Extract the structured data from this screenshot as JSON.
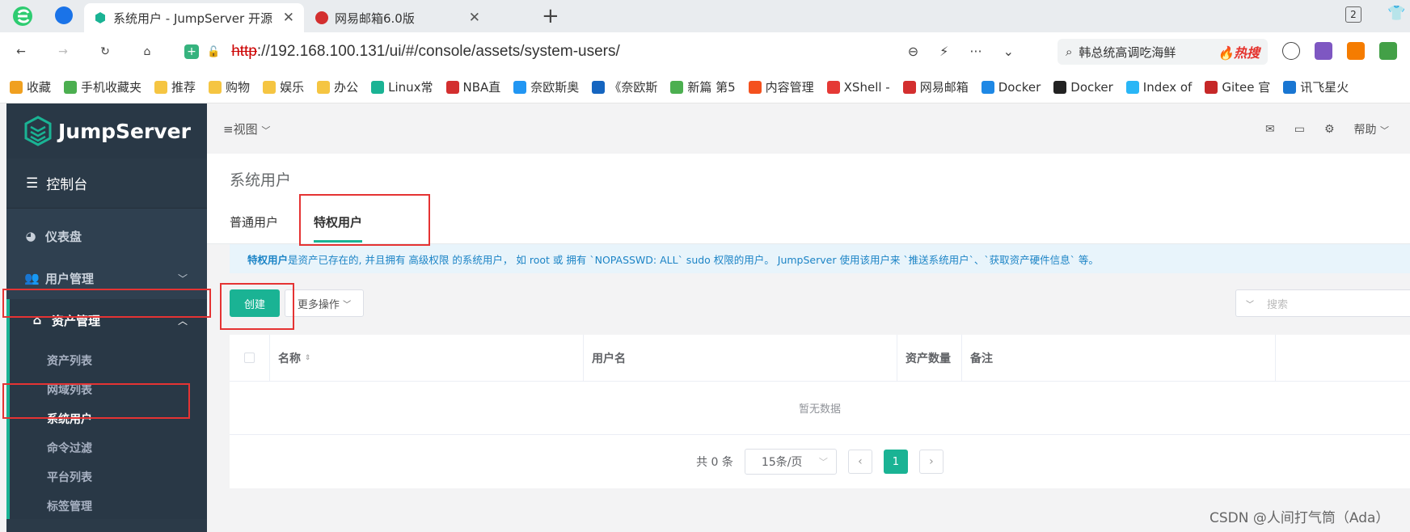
{
  "browser": {
    "tabs": [
      {
        "title": "系统用户 - JumpServer 开源",
        "close": "✕"
      },
      {
        "title": "网易邮箱6.0版",
        "close": "✕"
      }
    ],
    "new_tab": "+",
    "tab_count": "2",
    "url_scheme": "http",
    "url_rest": "://192.168.100.131/ui/#/console/assets/system-users/",
    "search_text": "韩总统高调吃海鲜",
    "search_hot": "🔥热搜"
  },
  "bookmarks": [
    {
      "label": "收藏",
      "color": "#f0a020"
    },
    {
      "label": "手机收藏夹",
      "color": "#4caf50"
    },
    {
      "label": "推荐",
      "color": "#f5c542"
    },
    {
      "label": "购物",
      "color": "#f5c542"
    },
    {
      "label": "娱乐",
      "color": "#f5c542"
    },
    {
      "label": "办公",
      "color": "#f5c542"
    },
    {
      "label": "Linux常",
      "color": "#1ab394"
    },
    {
      "label": "NBA直",
      "color": "#d32f2f"
    },
    {
      "label": "奈欧斯奥",
      "color": "#2196f3"
    },
    {
      "label": "《奈欧斯",
      "color": "#1565c0"
    },
    {
      "label": "新篇 第5",
      "color": "#4caf50"
    },
    {
      "label": "内容管理",
      "color": "#f4511e"
    },
    {
      "label": "XShell -",
      "color": "#e53935"
    },
    {
      "label": "网易邮箱",
      "color": "#d32f2f"
    },
    {
      "label": "Docker",
      "color": "#1e88e5"
    },
    {
      "label": "Docker",
      "color": "#222222"
    },
    {
      "label": "Index of",
      "color": "#29b6f6"
    },
    {
      "label": "Gitee 官",
      "color": "#c62828"
    },
    {
      "label": "讯飞星火",
      "color": "#1976d2"
    }
  ],
  "sidebar": {
    "brand": "JumpServer",
    "console": "控制台",
    "menus": [
      {
        "label": "仪表盘",
        "icon": "dashboard-icon"
      },
      {
        "label": "用户管理",
        "icon": "users-icon"
      },
      {
        "label": "资产管理",
        "icon": "inbox-icon"
      }
    ],
    "asset_submenu": [
      "资产列表",
      "网域列表",
      "系统用户",
      "命令过滤",
      "平台列表",
      "标签管理"
    ]
  },
  "topbar": {
    "view": "视图",
    "help": "帮助"
  },
  "page": {
    "title": "系统用户",
    "tabs": [
      "普通用户",
      "特权用户"
    ],
    "info_bold": "特权用户",
    "info_text": " 是资产已存在的, 并且拥有 高级权限 的系统用户， 如 root 或 拥有 `NOPASSWD: ALL` sudo 权限的用户。 JumpServer 使用该用户来 `推送系统用户`、`获取资产硬件信息` 等。",
    "create": "创建",
    "more": "更多操作",
    "search_placeholder": "搜索",
    "columns": [
      "名称",
      "用户名",
      "资产数量",
      "备注"
    ],
    "empty": "暂无数据",
    "total": "共 0 条",
    "page_size": "15条/页",
    "current_page": "1"
  },
  "watermark": "CSDN @人间打气筒（Ada）",
  "colors": {
    "accent": "#1ab394",
    "sidebar": "#2f4050",
    "highlight": "#e53333"
  }
}
